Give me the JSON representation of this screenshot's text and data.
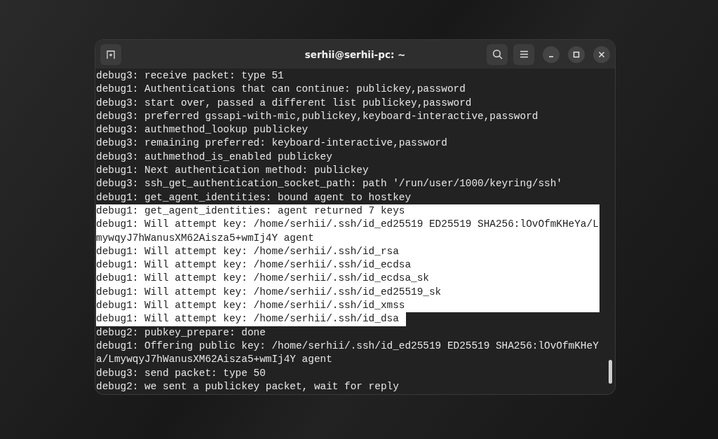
{
  "window": {
    "title": "serhii@serhii-pc: ~"
  },
  "terminal": {
    "lines": [
      {
        "text": "debug3: receive packet: type 51",
        "selected": false
      },
      {
        "text": "debug1: Authentications that can continue: publickey,password",
        "selected": false
      },
      {
        "text": "debug3: start over, passed a different list publickey,password",
        "selected": false
      },
      {
        "text": "debug3: preferred gssapi-with-mic,publickey,keyboard-interactive,password",
        "selected": false
      },
      {
        "text": "debug3: authmethod_lookup publickey",
        "selected": false
      },
      {
        "text": "debug3: remaining preferred: keyboard-interactive,password",
        "selected": false
      },
      {
        "text": "debug3: authmethod_is_enabled publickey",
        "selected": false
      },
      {
        "text": "debug1: Next authentication method: publickey",
        "selected": false
      },
      {
        "text": "debug3: ssh_get_authentication_socket_path: path '/run/user/1000/keyring/ssh'",
        "selected": false
      },
      {
        "text": "debug1: get_agent_identities: bound agent to hostkey",
        "selected": false
      },
      {
        "text": "debug1: get_agent_identities: agent returned 7 keys",
        "selected": true
      },
      {
        "text": "debug1: Will attempt key: /home/serhii/.ssh/id_ed25519 ED25519 SHA256:lOvOfmKHeYa/L",
        "selected": true
      },
      {
        "text": "mywqyJ7hWanusXM62Aisza5+wmIj4Y agent",
        "selected": true
      },
      {
        "text": "debug1: Will attempt key: /home/serhii/.ssh/id_rsa",
        "selected": true
      },
      {
        "text": "debug1: Will attempt key: /home/serhii/.ssh/id_ecdsa",
        "selected": true
      },
      {
        "text": "debug1: Will attempt key: /home/serhii/.ssh/id_ecdsa_sk",
        "selected": true
      },
      {
        "text": "debug1: Will attempt key: /home/serhii/.ssh/id_ed25519_sk",
        "selected": true
      },
      {
        "text": "debug1: Will attempt key: /home/serhii/.ssh/id_xmss",
        "selected": true
      },
      {
        "text": "debug1: Will attempt key: /home/serhii/.ssh/id_dsa",
        "selected": true
      },
      {
        "text": "debug2: pubkey_prepare: done",
        "selected": false
      },
      {
        "text": "debug1: Offering public key: /home/serhii/.ssh/id_ed25519 ED25519 SHA256:lOvOfmKHeY",
        "selected": false
      },
      {
        "text": "a/LmywqyJ7hWanusXM62Aisza5+wmIj4Y agent",
        "selected": false
      },
      {
        "text": "debug3: send packet: type 50",
        "selected": false
      },
      {
        "text": "debug2: we sent a publickey packet, wait for reply",
        "selected": false
      }
    ]
  }
}
